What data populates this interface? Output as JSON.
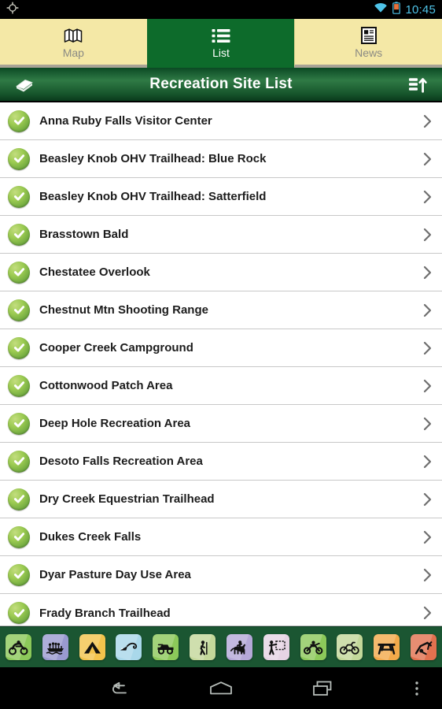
{
  "status_bar": {
    "location_icon": "gps-crosshair-icon",
    "wifi_icon": "wifi-icon",
    "battery_icon": "battery-icon",
    "time": "10:45"
  },
  "tabs": [
    {
      "label": "Map",
      "icon": "folded-map-icon",
      "active": false
    },
    {
      "label": "List",
      "icon": "bullet-list-icon",
      "active": true
    },
    {
      "label": "News",
      "icon": "newspaper-icon",
      "active": false
    }
  ],
  "action_bar": {
    "left_icon": "layers-stack-icon",
    "title": "Recreation Site List",
    "right_icon": "sort-ascending-icon"
  },
  "list": {
    "row_icon": "green-check-circle-icon",
    "row_chevron": "chevron-right-icon",
    "items": [
      {
        "name": "Anna Ruby Falls Visitor Center"
      },
      {
        "name": "Beasley Knob OHV Trailhead: Blue Rock"
      },
      {
        "name": "Beasley Knob OHV Trailhead: Satterfield"
      },
      {
        "name": "Brasstown Bald"
      },
      {
        "name": "Chestatee Overlook"
      },
      {
        "name": "Chestnut Mtn Shooting Range"
      },
      {
        "name": "Cooper Creek Campground"
      },
      {
        "name": "Cottonwood Patch Area"
      },
      {
        "name": "Deep Hole Recreation Area"
      },
      {
        "name": "Desoto Falls Recreation Area"
      },
      {
        "name": "Dry Creek Equestrian Trailhead"
      },
      {
        "name": "Dukes Creek Falls"
      },
      {
        "name": "Dyar Pasture Day Use Area"
      },
      {
        "name": "Frady Branch Trailhead"
      }
    ]
  },
  "activity_bar": {
    "items": [
      {
        "icon": "atv-icon",
        "color": "#8cc95a"
      },
      {
        "icon": "boating-icon",
        "color": "#9a9ad0"
      },
      {
        "icon": "camping-tent-icon",
        "color": "#f5c council"
      },
      {
        "icon": "fishing-icon",
        "color": "#a9d8ea"
      },
      {
        "icon": "off-road-jeep-icon",
        "color": "#8cc95a"
      },
      {
        "icon": "hiking-icon",
        "color": "#c3d89a"
      },
      {
        "icon": "horseback-riding-icon",
        "color": "#b5a8d8"
      },
      {
        "icon": "interpretive-sign-icon",
        "color": "#e6d4e4"
      },
      {
        "icon": "motorcycle-icon",
        "color": "#8cc95a"
      },
      {
        "icon": "bicycling-icon",
        "color": "#c3d89a"
      },
      {
        "icon": "picnic-table-icon",
        "color": "#f3a94a"
      },
      {
        "icon": "playground-icon",
        "color": "#e2714f"
      }
    ]
  },
  "nav_bar": {
    "back_label": "back-icon",
    "home_label": "home-icon",
    "recents_label": "recents-icon",
    "overflow_label": "overflow-menu-icon"
  },
  "colors": {
    "tab_inactive_bg": "#f4e8a6",
    "tab_active_bg": "#0d6b2b",
    "action_bar_green": "#2f7a45",
    "icon_bar_green": "#1b5632",
    "status_accent": "#4fc3e8",
    "check_green": "#7cb342"
  }
}
